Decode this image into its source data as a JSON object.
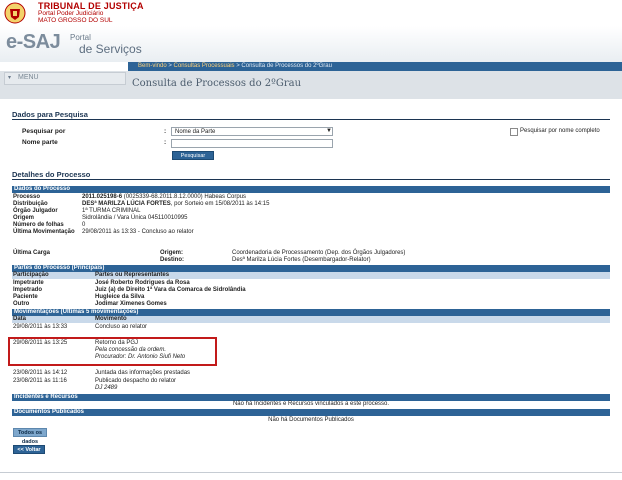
{
  "header": {
    "tribunal_line1": "TRIBUNAL DE JUSTIÇA",
    "tribunal_line2": "Portal Poder Judiciário",
    "tribunal_line3": "MATO GROSSO DO SUL",
    "esaj_logo": "e-SAJ",
    "portal_line1": "Portal",
    "portal_line2": "de Serviços"
  },
  "breadcrumb": {
    "item1": "Bem-vindo",
    "sep": " > ",
    "item2": "Consultas Processuais",
    "item3": "Consulta de Processos do 2ºGrau"
  },
  "menu": {
    "label": "MENU",
    "icon": "chevron-down-icon"
  },
  "page_title": "Consulta de Processos do 2ºGrau",
  "search": {
    "title": "Dados para Pesquisa",
    "search_by_label": "Pesquisar por",
    "search_by_value": "Nome da Parte",
    "name_label": "Nome parte",
    "name_value": "",
    "colon": ":",
    "button": "Pesquisar",
    "full_name_label": "Pesquisar por nome completo"
  },
  "details": {
    "title": "Detalhes do Processo",
    "section_dados": "Dados do Processo",
    "processo_label": "Processo",
    "processo_value": "2011.025198-6",
    "processo_extra": "(0025339-68.2011.8.12.0000)  Habeas Corpus",
    "distribuicao_label": "Distribuição",
    "distribuicao_name": "DESª MARILZA LÚCIA FORTES",
    "distribuicao_rest": ", por Sorteio em 15/08/2011  às 14:15",
    "orgao_label": "Órgão Julgador",
    "orgao_value": "1ª TURMA CRIMINAL",
    "origem_label": "Origem",
    "origem_value": "Sidrolândia / Vara Única 045110010995",
    "folhas_label": "Número de folhas",
    "folhas_value": "0",
    "ultima_mov_label": "Última Movimentação",
    "ultima_mov_value": "29/08/2011  às 13:33 - Concluso ao relator",
    "carga_label": "Última Carga",
    "carga_origem_label": "Origem:",
    "carga_origem_value": "Coordenadoria de Processamento (Dep. dos Órgãos Julgadores)",
    "carga_destino_label": "Destino:",
    "carga_destino_value": "Desª Marilza Lúcia Fortes (Desembargador-Relator)"
  },
  "partes": {
    "section": "Partes do Processo (Principais)",
    "col1": "Participação",
    "col2": "Partes ou Representantes",
    "rows": [
      {
        "role": "Impetrante",
        "name": "José Roberto Rodrigues da Rosa"
      },
      {
        "role": "Impetrado",
        "name": "Juiz (a) de Direito 1ª Vara da Comarca de Sidrolândia"
      },
      {
        "role": "Paciente",
        "name": "Hugleice da Silva"
      },
      {
        "role": "Outro",
        "name": "Jodimar Ximenes Gomes"
      }
    ]
  },
  "movimentacoes": {
    "section": "Movimentações (Últimas 5 movimentações)",
    "col1": "Data",
    "col2": "Movimento",
    "rows": [
      {
        "date": "29/08/2011 às 13:33",
        "text": "Concluso ao relator",
        "sub1": "",
        "sub2": ""
      },
      {
        "date": "29/08/2011 às 13:25",
        "text": "Retorno da PGJ",
        "sub1": "Pela concessão da ordem.",
        "sub2": "Procurador: Dr. Antonio Siufi Neto"
      },
      {
        "date": "23/08/2011 às 14:12",
        "text": "Juntada das informações prestadas",
        "sub1": "",
        "sub2": ""
      },
      {
        "date": "23/08/2011 às 11:16",
        "text": "Publicado despacho do relator",
        "sub1": "DJ 2489",
        "sub2": ""
      }
    ]
  },
  "incidentes": {
    "section": "Incidentes e Recursos",
    "empty": "Não há Incidentes e Recursos vinculados a este processo."
  },
  "documentos": {
    "section": "Documentos Publicados",
    "empty": "Não há Documentos Publicados"
  },
  "buttons": {
    "todos": "Todos os dados",
    "voltar": "<< Voltar"
  },
  "colors": {
    "primary": "#2d6396",
    "section_header": "#2d6396",
    "highlight": "#c21a1a",
    "brand_red": "#b30000"
  }
}
